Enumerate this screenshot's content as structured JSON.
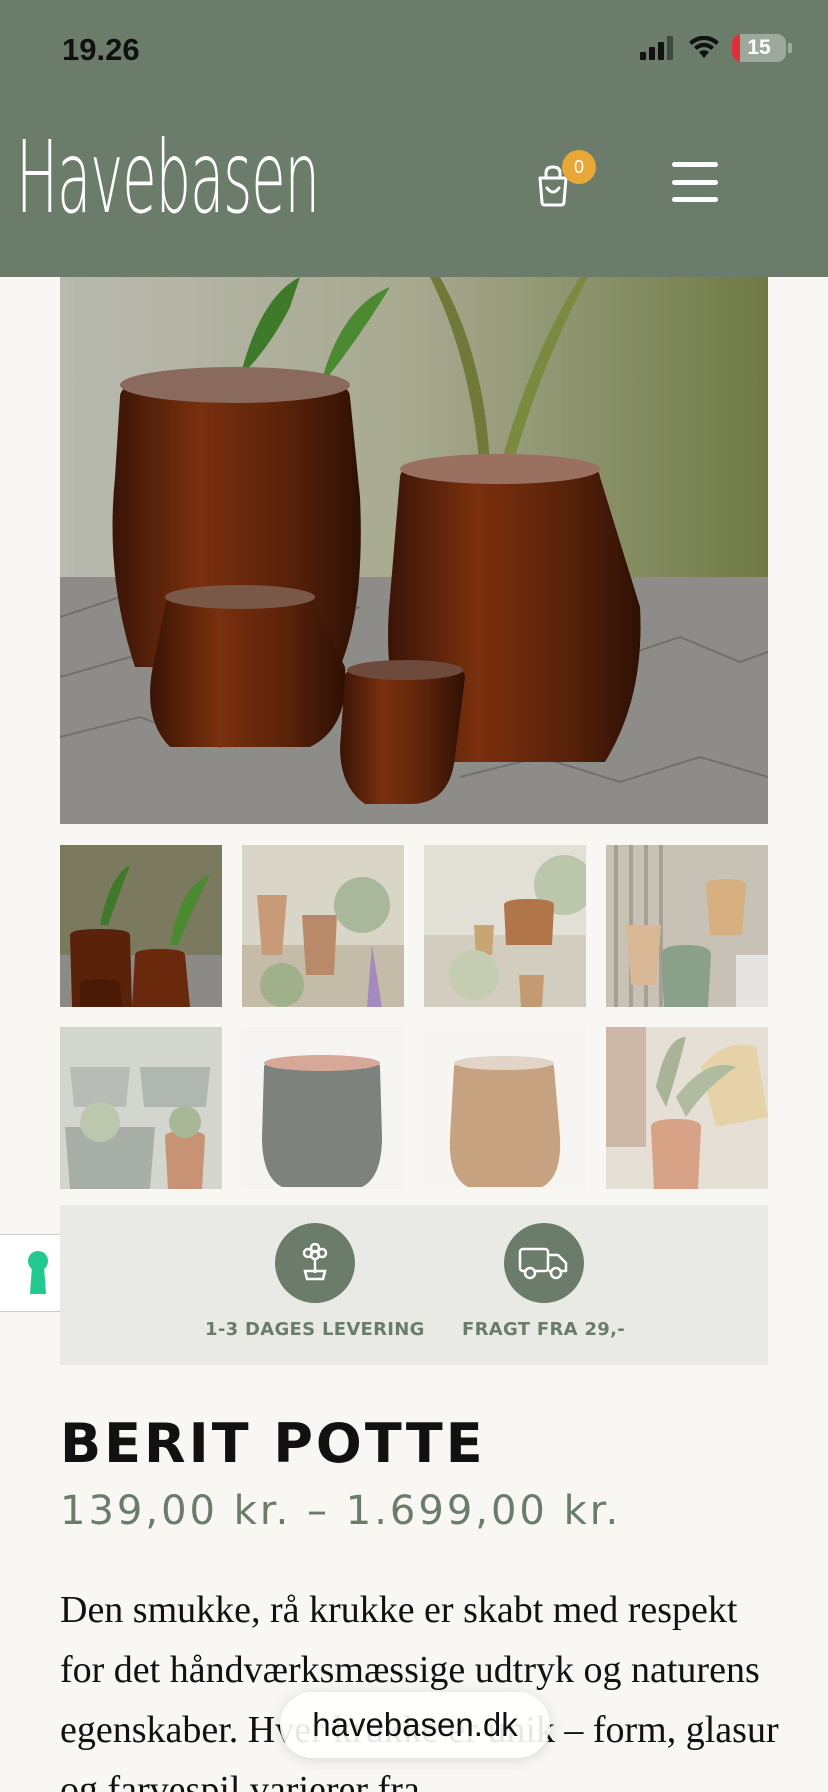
{
  "status_bar": {
    "time": "19.26",
    "battery": "15",
    "battery_level": 0.15
  },
  "header": {
    "logo": "Havebasen",
    "cart_count": "0",
    "menu_icon": "hamburger-icon",
    "cart_icon": "shopping-bag-icon",
    "background_color": "#6b7c6b",
    "badge_color": "#e8a838"
  },
  "gallery": {
    "main_image": "glazed brown pots photo",
    "thumbnails": [
      "pots-with-plants",
      "terracotta-garden",
      "garden-stairs",
      "wooden-fence-pots",
      "grey-planters",
      "dark-glazed-pot",
      "brown-glazed-pot",
      "pot-with-plant-chair"
    ]
  },
  "features": [
    {
      "icon": "flower-icon",
      "label": "1-3 DAGES LEVERING"
    },
    {
      "icon": "truck-icon",
      "label": "FRAGT FRA 29,-"
    }
  ],
  "product": {
    "title": "BERIT POTTE",
    "price": "139,00 kr. – 1.699,00 kr.",
    "description": "Den smukke, rå krukke er skabt med respekt for det håndværksmæssige udtryk og naturens egenskaber. Hver krukke er unik – form, glasur og farvespil varierer fra"
  },
  "accessibility": {
    "icon": "keyhole-icon"
  },
  "browser": {
    "url": "havebasen.dk"
  }
}
